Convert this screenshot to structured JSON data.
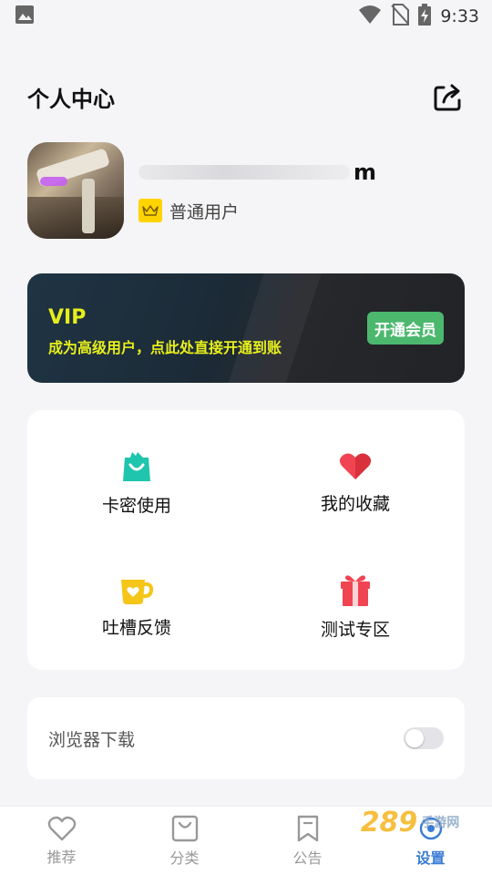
{
  "status_bar": {
    "time": "9:33",
    "icons": [
      "image-icon",
      "wifi-icon",
      "no-sim-icon",
      "battery-charging-icon"
    ]
  },
  "header": {
    "title": "个人中心",
    "share_icon": "share-icon"
  },
  "profile": {
    "username_visible_tail": "m",
    "role": "普通用户",
    "badge_icon": "crown-icon"
  },
  "vip": {
    "title": "VIP",
    "description": "成为高级用户，点此处直接开通到账",
    "button_label": "开通会员",
    "accent_color": "#e7ef1b",
    "button_color": "#4cb86e"
  },
  "features": [
    {
      "label": "卡密使用",
      "icon": "shopping-bag-icon",
      "color": "#20c5ad"
    },
    {
      "label": "我的收藏",
      "icon": "heart-icon",
      "color": "#f04452"
    },
    {
      "label": "吐槽反馈",
      "icon": "coffee-cup-icon",
      "color": "#f5c518"
    },
    {
      "label": "测试专区",
      "icon": "gift-icon",
      "color": "#f04452"
    }
  ],
  "settings": {
    "browser_download_label": "浏览器下载",
    "browser_download_enabled": false
  },
  "bottom_nav": [
    {
      "label": "推荐",
      "icon": "heart-outline-icon",
      "active": false
    },
    {
      "label": "分类",
      "icon": "bag-outline-icon",
      "active": false
    },
    {
      "label": "公告",
      "icon": "bookmark-outline-icon",
      "active": false
    },
    {
      "label": "设置",
      "icon": "settings-icon",
      "active": true
    }
  ],
  "watermark": {
    "main": "289",
    "sub": "手游网"
  }
}
